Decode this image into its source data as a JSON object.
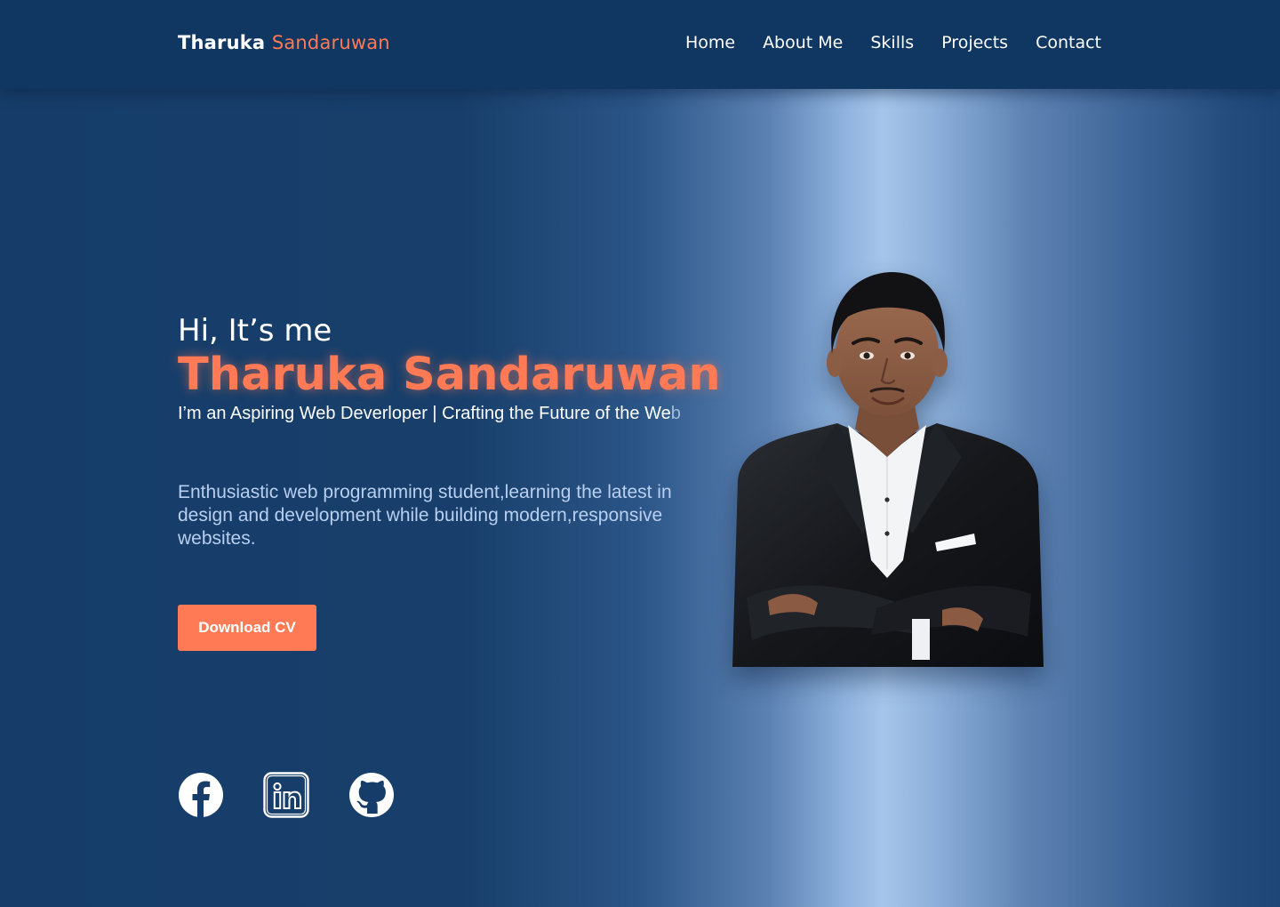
{
  "brand": {
    "first": "Tharuka",
    "last": "Sandaruwan",
    "accent_color": "#ff7a55"
  },
  "nav": {
    "items": [
      "Home",
      "About Me",
      "Skills",
      "Projects",
      "Contact"
    ]
  },
  "hero": {
    "greeting": "Hi, It’s me",
    "name": "Tharuka Sandaruwan",
    "tagline": "I’m an Aspiring Web Deverloper | Crafting the Future of the We",
    "tagline_caret": "b",
    "description": "Enthusiastic web programming student,learning the latest in design and development while building modern,responsive websites.",
    "cta_label": "Download CV"
  },
  "socials": {
    "items": [
      "facebook-icon",
      "linkedin-icon",
      "github-icon"
    ]
  },
  "colors": {
    "navbar": "#0f3762",
    "background": "#163d69",
    "accent": "#ff7a55",
    "description_text": "#b8cff0"
  }
}
